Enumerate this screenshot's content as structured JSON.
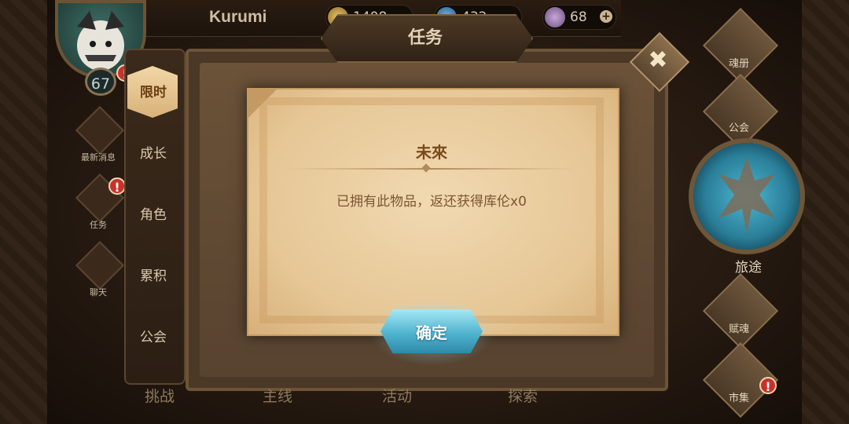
{
  "player": {
    "name": "Kurumi",
    "level": "67"
  },
  "resources": [
    {
      "icon": "gold-coin-icon",
      "value": "1408"
    },
    {
      "icon": "gem-icon",
      "value": "432"
    },
    {
      "icon": "stamina-icon",
      "value": "68"
    }
  ],
  "left_menu": [
    {
      "label": "最新消息",
      "icon": "news-icon"
    },
    {
      "label": "任务",
      "icon": "quest-icon"
    },
    {
      "label": "聊天",
      "icon": "chat-icon"
    }
  ],
  "panel": {
    "title": "任务",
    "tabs": [
      "限时",
      "成长",
      "角色",
      "累积",
      "公会"
    ],
    "active_tab": "限时"
  },
  "bottom_nav": [
    "挑战",
    "主线",
    "活动",
    "探索"
  ],
  "right_nav": [
    {
      "label": "魂册",
      "icon": "soul-book-icon"
    },
    {
      "label": "公会",
      "icon": "guild-icon"
    },
    {
      "label": "旅途",
      "icon": "journey-icon"
    },
    {
      "label": "赋魂",
      "icon": "ensoul-icon"
    },
    {
      "label": "市集",
      "icon": "market-icon"
    }
  ],
  "dialog": {
    "title": "未來",
    "message": "已拥有此物品，返还获得库伦x0",
    "confirm_label": "确定"
  },
  "colors": {
    "parchment": "#e6c796",
    "confirm_button": "#4fb3cf",
    "alert_badge": "#c8322a"
  }
}
